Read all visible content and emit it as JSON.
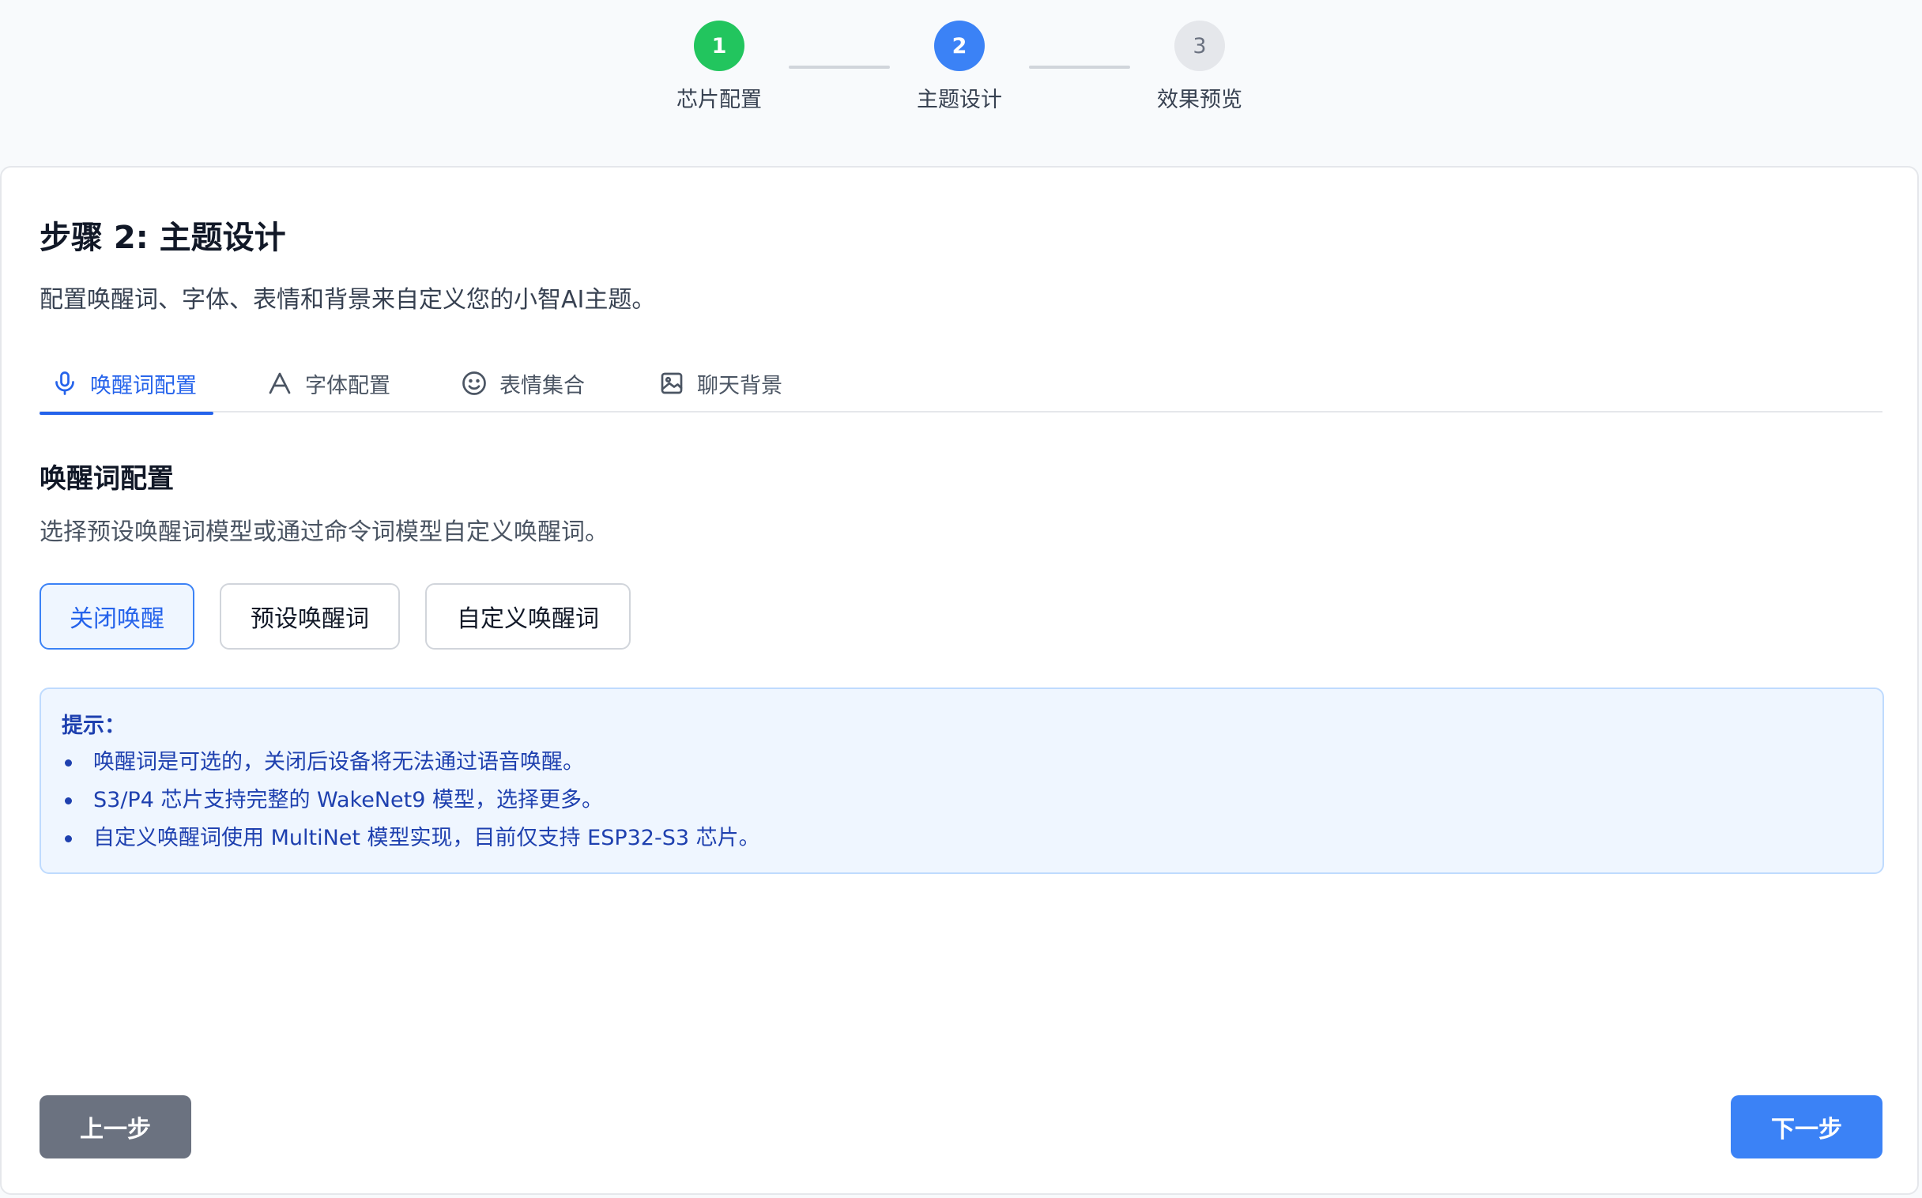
{
  "stepper": {
    "steps": [
      {
        "number": "1",
        "label": "芯片配置",
        "state": "done"
      },
      {
        "number": "2",
        "label": "主题设计",
        "state": "active"
      },
      {
        "number": "3",
        "label": "效果预览",
        "state": "todo"
      }
    ]
  },
  "card": {
    "title": "步骤 2: 主题设计",
    "description": "配置唤醒词、字体、表情和背景来自定义您的小智AI主题。"
  },
  "tabs": [
    {
      "label": "唤醒词配置",
      "icon": "microphone-icon",
      "active": true
    },
    {
      "label": "字体配置",
      "icon": "font-icon",
      "active": false
    },
    {
      "label": "表情集合",
      "icon": "smiley-icon",
      "active": false
    },
    {
      "label": "聊天背景",
      "icon": "image-icon",
      "active": false
    }
  ],
  "section": {
    "title": "唤醒词配置",
    "description": "选择预设唤醒词模型或通过命令词模型自定义唤醒词。",
    "options": [
      {
        "label": "关闭唤醒",
        "selected": true
      },
      {
        "label": "预设唤醒词",
        "selected": false
      },
      {
        "label": "自定义唤醒词",
        "selected": false
      }
    ]
  },
  "tip": {
    "title": "提示：",
    "items": [
      "唤醒词是可选的，关闭后设备将无法通过语音唤醒。",
      "S3/P4 芯片支持完整的 WakeNet9 模型，选择更多。",
      "自定义唤醒词使用 MultiNet 模型实现，目前仅支持 ESP32-S3 芯片。"
    ]
  },
  "nav": {
    "prev_label": "上一步",
    "next_label": "下一步"
  },
  "colors": {
    "accent": "#3b82f6",
    "done": "#22c55e",
    "tip_bg": "#eff6ff",
    "tip_text": "#1e40af"
  }
}
